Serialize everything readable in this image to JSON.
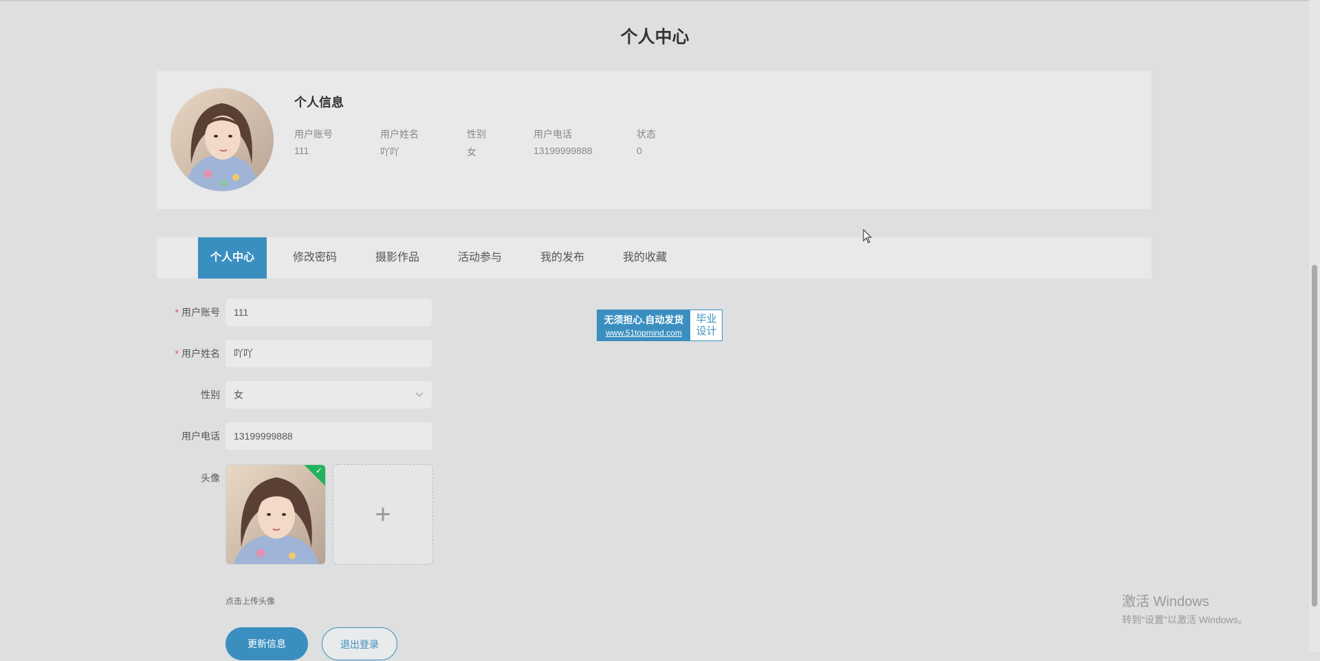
{
  "page": {
    "title": "个人中心"
  },
  "profile": {
    "section_title": "个人信息",
    "fields": [
      {
        "label": "用户账号",
        "value": "111"
      },
      {
        "label": "用户姓名",
        "value": "吖吖"
      },
      {
        "label": "性别",
        "value": "女"
      },
      {
        "label": "用户电话",
        "value": "13199999888"
      },
      {
        "label": "状态",
        "value": "0"
      }
    ]
  },
  "tabs": [
    {
      "label": "个人中心",
      "active": true
    },
    {
      "label": "修改密码",
      "active": false
    },
    {
      "label": "摄影作品",
      "active": false
    },
    {
      "label": "活动参与",
      "active": false
    },
    {
      "label": "我的发布",
      "active": false
    },
    {
      "label": "我的收藏",
      "active": false
    }
  ],
  "form": {
    "account": {
      "label": "用户账号",
      "required": "*",
      "value": "111"
    },
    "name": {
      "label": "用户姓名",
      "required": "*",
      "value": "吖吖"
    },
    "gender": {
      "label": "性别",
      "value": "女"
    },
    "phone": {
      "label": "用户电话",
      "value": "13199999888"
    },
    "avatar": {
      "label": "头像",
      "hint": "点击上传头像",
      "add_glyph": "+"
    },
    "buttons": {
      "update": "更新信息",
      "logout": "退出登录"
    }
  },
  "badge": {
    "line1": "无须担心.自动发货",
    "line2": "www.51topmind.com",
    "right1": "毕业",
    "right2": "设计"
  },
  "windows_activation": {
    "title": "激活 Windows",
    "subtitle": "转到\"设置\"以激活 Windows。"
  },
  "colors": {
    "primary": "#3a8fc0",
    "required": "#e05555",
    "success": "#22b35e"
  },
  "icons": {
    "dropdown": "chevron-down-icon",
    "upload": "plus-icon",
    "uploaded": "check-icon"
  }
}
